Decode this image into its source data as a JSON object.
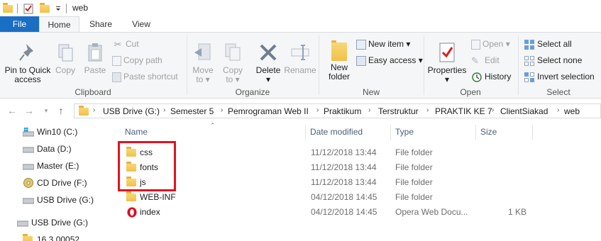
{
  "window": {
    "title": "web"
  },
  "tabs": {
    "file": "File",
    "home": "Home",
    "share": "Share",
    "view": "View"
  },
  "ribbon": {
    "clipboard": {
      "label": "Clipboard",
      "pin": "Pin to Quick access",
      "pin_l1": "Pin to Quick",
      "pin_l2": "access",
      "copy": "Copy",
      "paste": "Paste",
      "cut": "Cut",
      "copy_path": "Copy path",
      "paste_shortcut": "Paste shortcut"
    },
    "organize": {
      "label": "Organize",
      "move_l1": "Move",
      "move_l2": "to",
      "copy_l1": "Copy",
      "copy_l2": "to",
      "delete": "Delete",
      "rename": "Rename"
    },
    "new": {
      "label": "New",
      "folder_l1": "New",
      "folder_l2": "folder",
      "new_item": "New item",
      "easy_access": "Easy access"
    },
    "open": {
      "label": "Open",
      "properties": "Properties",
      "open": "Open",
      "edit": "Edit",
      "history": "History"
    },
    "select": {
      "label": "Select",
      "select_all": "Select all",
      "select_none": "Select none",
      "invert": "Invert selection"
    }
  },
  "address": {
    "crumbs": [
      "USB Drive (G:)",
      "Semester 5",
      "Pemrograman Web II",
      "Praktikum",
      "Terstruktur",
      "PRAKTIK KE 7",
      "ClientSiakad",
      "web"
    ]
  },
  "sidebar": {
    "items": [
      {
        "label": "Win10 (C:)"
      },
      {
        "label": "Data (D:)"
      },
      {
        "label": "Master (E:)"
      },
      {
        "label": "CD Drive (F:)"
      },
      {
        "label": "USB Drive (G:)"
      },
      {
        "label": "USB Drive (G:)"
      },
      {
        "label": "16.3.00052"
      }
    ]
  },
  "columns": {
    "name": "Name",
    "date": "Date modified",
    "type": "Type",
    "size": "Size"
  },
  "files": [
    {
      "name": "css",
      "date": "11/12/2018 13:44",
      "type": "File folder",
      "size": "",
      "icon": "folder-icon"
    },
    {
      "name": "fonts",
      "date": "11/12/2018 13:44",
      "type": "File folder",
      "size": "",
      "icon": "folder-icon"
    },
    {
      "name": "js",
      "date": "11/12/2018 13:44",
      "type": "File folder",
      "size": "",
      "icon": "folder-icon"
    },
    {
      "name": "WEB-INF",
      "date": "04/12/2018 14:45",
      "type": "File folder",
      "size": "",
      "icon": "folder-icon"
    },
    {
      "name": "index",
      "date": "04/12/2018 14:45",
      "type": "Opera Web Docu...",
      "size": "1 KB",
      "icon": "opera-icon"
    }
  ],
  "colors": {
    "file_tab": "#1a6fc4",
    "highlight": "#e0141e",
    "folder": "#f0c14a",
    "header_text": "#4c607a"
  }
}
